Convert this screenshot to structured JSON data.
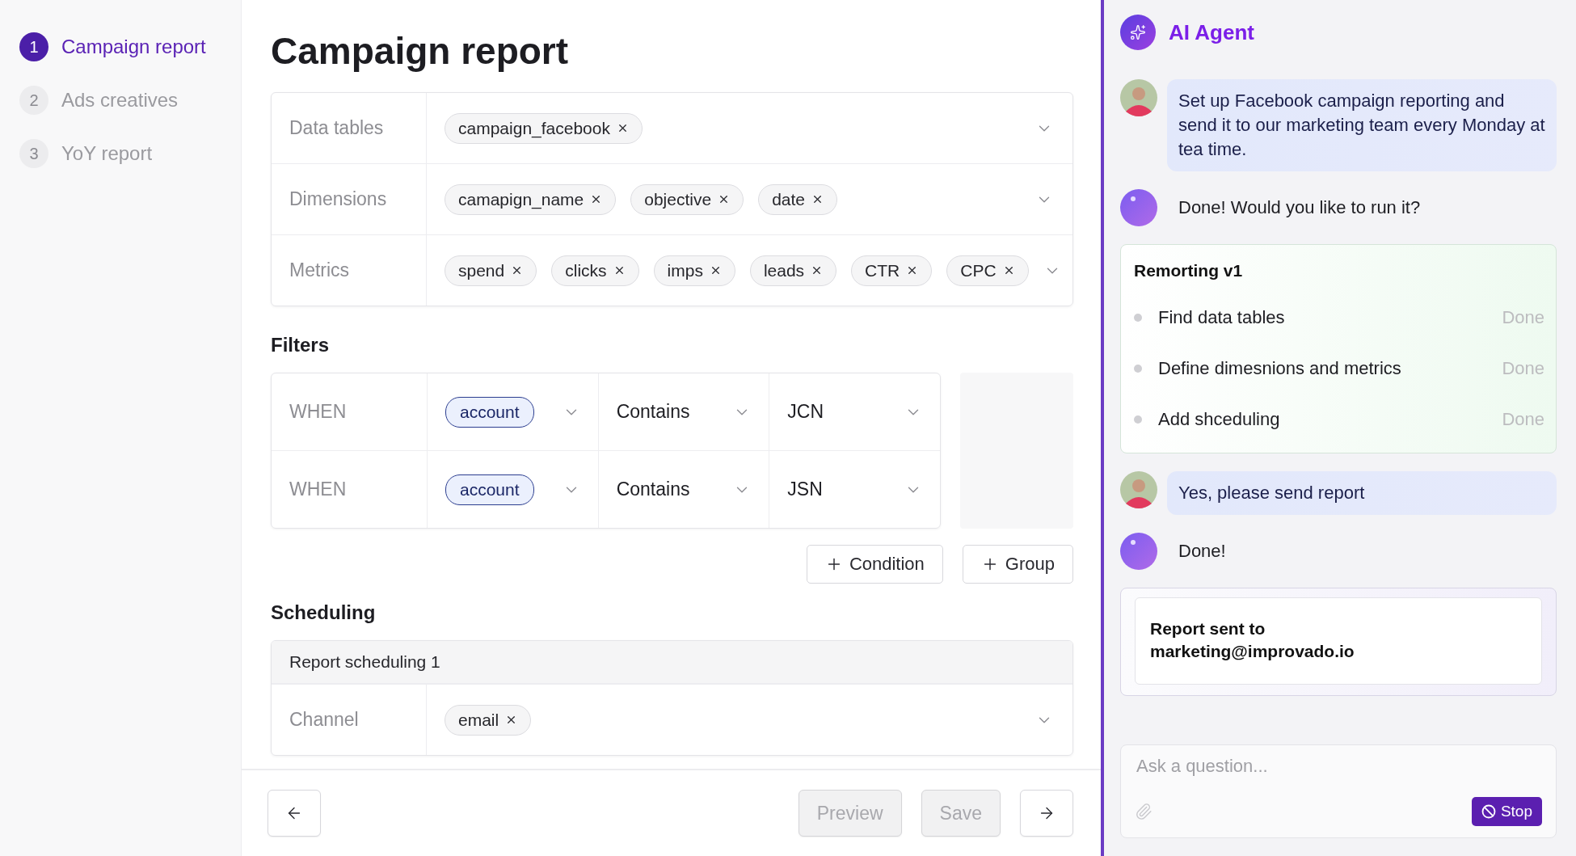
{
  "steps": [
    {
      "number": "1",
      "label": "Campaign report",
      "selected": true
    },
    {
      "number": "2",
      "label": "Ads creatives",
      "selected": false
    },
    {
      "number": "3",
      "label": "YoY report",
      "selected": false
    }
  ],
  "page_title": "Campaign report",
  "fields": [
    {
      "label": "Data tables",
      "chips": [
        "campaign_facebook"
      ]
    },
    {
      "label": "Dimensions",
      "chips": [
        "camapign_name",
        "objective",
        "date"
      ]
    },
    {
      "label": "Metrics",
      "chips": [
        "spend",
        "clicks",
        "imps",
        "leads",
        "CTR",
        "CPC"
      ]
    }
  ],
  "filters": {
    "title": "Filters",
    "rows": [
      {
        "keyword": "WHEN",
        "field": "account",
        "operator": "Contains",
        "value": "JCN"
      },
      {
        "keyword": "WHEN",
        "field": "account",
        "operator": "Contains",
        "value": "JSN"
      }
    ],
    "buttons": [
      "Condition",
      "Group"
    ]
  },
  "scheduling": {
    "title": "Scheduling",
    "group_title": "Report scheduling 1",
    "fields": [
      {
        "label": "Channel",
        "chips": [
          "email"
        ]
      }
    ]
  },
  "footer": [
    {
      "kind": "back",
      "disabled": false
    },
    {
      "kind": "text",
      "label": "Preview",
      "disabled": true
    },
    {
      "kind": "text",
      "label": "Save",
      "disabled": true
    },
    {
      "kind": "next",
      "disabled": false
    }
  ],
  "agent": {
    "title": "AI Agent",
    "messages": [
      {
        "kind": "user",
        "text": "Set up Facebook campaign reporting and send it to our marketing team every Monday at tea time."
      },
      {
        "kind": "bot",
        "text": "Done! Would you like to run it?"
      },
      {
        "kind": "plan",
        "title": "Remorting v1",
        "steps": [
          {
            "label": "Find data tables",
            "status": "Done"
          },
          {
            "label": "Define dimesnions and metrics",
            "status": "Done"
          },
          {
            "label": "Add shceduling",
            "status": "Done"
          }
        ]
      },
      {
        "kind": "user",
        "text": "Yes, please send report"
      },
      {
        "kind": "bot",
        "text": "Done!"
      },
      {
        "kind": "result",
        "text": "Report sent to marketing@improvado.io"
      }
    ],
    "input": {
      "placeholder": "Ask a question...",
      "button": "Stop"
    }
  }
}
